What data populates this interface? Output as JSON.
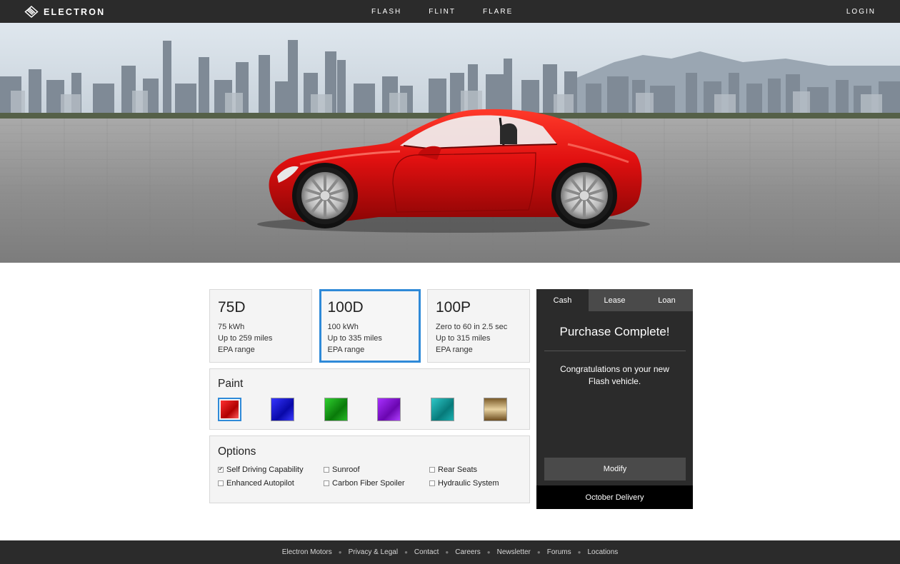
{
  "brand": {
    "name": "ELECTRON",
    "logo_icon": "electron-logo-icon"
  },
  "nav": {
    "links": [
      "FLASH",
      "FLINT",
      "FLARE"
    ],
    "login": "LOGIN"
  },
  "hero": {
    "image": "red sports car parked in front of city skyline",
    "car_color": "#e01010"
  },
  "models": [
    {
      "name": "75D",
      "lines": [
        "75 kWh",
        "Up to 259 miles",
        "EPA range"
      ],
      "selected": false
    },
    {
      "name": "100D",
      "lines": [
        "100 kWh",
        "Up to 335 miles",
        "EPA range"
      ],
      "selected": true
    },
    {
      "name": "100P",
      "lines": [
        "Zero to 60 in 2.5 sec",
        "Up to 315 miles",
        "EPA range"
      ],
      "selected": false
    }
  ],
  "paint": {
    "title": "Paint",
    "colors": [
      {
        "name": "red",
        "hex": "#d40c0c",
        "selected": true
      },
      {
        "name": "blue",
        "hex": "#1010c8",
        "selected": false
      },
      {
        "name": "green",
        "hex": "#0f9a12",
        "selected": false
      },
      {
        "name": "purple",
        "hex": "#8a0fd0",
        "selected": false
      },
      {
        "name": "teal",
        "hex": "#0f9a9a",
        "selected": false
      },
      {
        "name": "bronze",
        "hex": "#a88248",
        "selected": false
      }
    ]
  },
  "options": {
    "title": "Options",
    "items": [
      {
        "label": "Self Driving Capability",
        "checked": true
      },
      {
        "label": "Sunroof",
        "checked": false
      },
      {
        "label": "Rear Seats",
        "checked": false
      },
      {
        "label": "Enhanced Autopilot",
        "checked": false
      },
      {
        "label": "Carbon Fiber Spoiler",
        "checked": false
      },
      {
        "label": "Hydraulic System",
        "checked": false
      }
    ]
  },
  "purchase": {
    "tabs": [
      "Cash",
      "Lease",
      "Loan"
    ],
    "active_tab": "Cash",
    "title": "Purchase Complete!",
    "message": "Congratulations on your new Flash vehicle.",
    "modify_label": "Modify",
    "delivery": "October Delivery"
  },
  "footer": {
    "links": [
      "Electron Motors",
      "Privacy & Legal",
      "Contact",
      "Careers",
      "Newsletter",
      "Forums",
      "Locations"
    ]
  },
  "colors": {
    "nav_bg": "#2b2b2b",
    "accent": "#2f8ad8",
    "panel_bg": "#f4f4f4",
    "purchase_bg": "#2b2b2b"
  }
}
